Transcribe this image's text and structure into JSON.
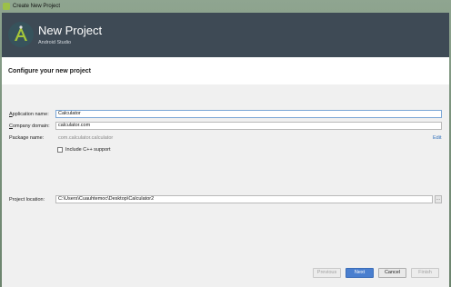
{
  "window": {
    "title": "Create New Project"
  },
  "header": {
    "title": "New Project",
    "subtitle": "Android Studio",
    "logo_icon": "android-studio-logo-icon"
  },
  "section": {
    "title": "Configure your new project"
  },
  "form": {
    "app_name": {
      "label_first": "A",
      "label_rest": "pplication name:",
      "value": "Calculator"
    },
    "company_domain": {
      "label_first": "C",
      "label_rest": "ompany domain:",
      "value": "calculator.com"
    },
    "package_name": {
      "label": "Package name:",
      "value": "com.calculator.calculator",
      "edit_label": "Edit"
    },
    "include_cpp": {
      "label": "Include C++ support",
      "checked": false
    },
    "project_location": {
      "label": "Project location:",
      "value": "C:\\Users\\Cuauhtemoc\\Desktop\\Calculator2",
      "browse_label": "..."
    }
  },
  "buttons": {
    "previous": "Previous",
    "next": "Next",
    "cancel": "Cancel",
    "finish": "Finish"
  },
  "colors": {
    "accent": "#4a7fcf",
    "header_bg": "#3e4a55",
    "link": "#2f6fba"
  }
}
